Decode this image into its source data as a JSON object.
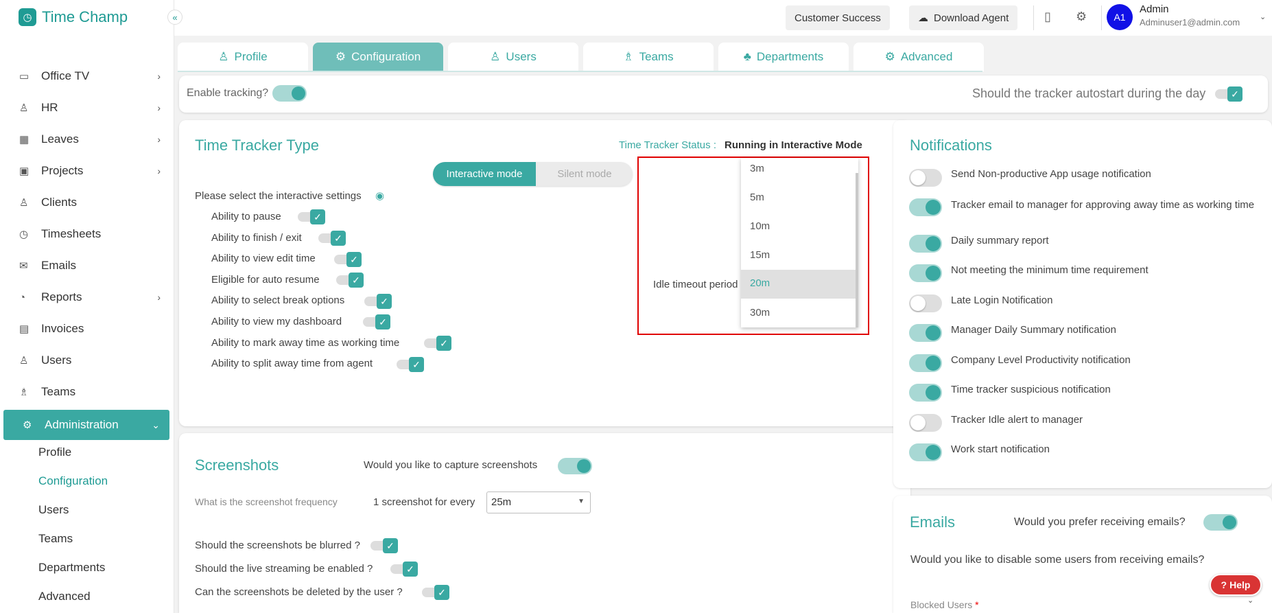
{
  "app": {
    "name": "Time Champ"
  },
  "topbar": {
    "customer_success": "Customer Success",
    "download_agent": "Download Agent",
    "user_name": "Admin",
    "user_email": "Adminuser1@admin.com",
    "avatar_initials": "A1"
  },
  "sidebar": {
    "items": [
      {
        "label": "Office TV"
      },
      {
        "label": "HR"
      },
      {
        "label": "Leaves"
      },
      {
        "label": "Projects"
      },
      {
        "label": "Clients"
      },
      {
        "label": "Timesheets"
      },
      {
        "label": "Emails"
      },
      {
        "label": "Reports"
      },
      {
        "label": "Invoices"
      },
      {
        "label": "Users"
      },
      {
        "label": "Teams"
      },
      {
        "label": "Administration"
      }
    ],
    "sub_items": [
      {
        "label": "Profile"
      },
      {
        "label": "Configuration"
      },
      {
        "label": "Users"
      },
      {
        "label": "Teams"
      },
      {
        "label": "Departments"
      },
      {
        "label": "Advanced"
      }
    ]
  },
  "tabs": [
    {
      "label": "Profile"
    },
    {
      "label": "Configuration"
    },
    {
      "label": "Users"
    },
    {
      "label": "Teams"
    },
    {
      "label": "Departments"
    },
    {
      "label": "Advanced"
    }
  ],
  "tracking": {
    "enable_label": "Enable tracking?",
    "autostart_label": "Should the tracker autostart during the day"
  },
  "tracker_type": {
    "title": "Time Tracker Type",
    "status_label": "Time Tracker Status :",
    "status_value": "Running in Interactive Mode",
    "mode_interactive": "Interactive mode",
    "mode_silent": "Silent mode",
    "select_label": "Please select the interactive settings",
    "settings": [
      {
        "label": "Ability to pause"
      },
      {
        "label": "Ability to finish / exit"
      },
      {
        "label": "Ability to view edit time"
      },
      {
        "label": "Eligible for auto resume"
      },
      {
        "label": "Ability to select break options"
      },
      {
        "label": "Ability to view my dashboard"
      },
      {
        "label": "Ability to mark away time as working time"
      },
      {
        "label": "Ability to split away time from agent"
      }
    ],
    "idle_label": "Idle timeout period",
    "idle_options": [
      "3m",
      "5m",
      "10m",
      "15m",
      "20m",
      "30m"
    ],
    "idle_selected": "20m"
  },
  "screenshots": {
    "title": "Screenshots",
    "capture_label": "Would you like to capture screenshots",
    "frequency_label": "What is the screenshot frequency",
    "every_label": "1 screenshot for every",
    "frequency_value": "25m",
    "blur_label": "Should the screenshots be blurred ?",
    "stream_label": "Should the live streaming be enabled ?",
    "delete_label": "Can the screenshots be deleted by the user ?"
  },
  "notifications": {
    "title": "Notifications",
    "items": [
      {
        "label": "Send Non-productive App usage notification",
        "on": false
      },
      {
        "label": "Tracker email to manager for approving away time as working time",
        "on": true
      },
      {
        "label": "Daily summary report",
        "on": true
      },
      {
        "label": "Not meeting the minimum time requirement",
        "on": true
      },
      {
        "label": "Late Login Notification",
        "on": false
      },
      {
        "label": "Manager Daily Summary notification",
        "on": true
      },
      {
        "label": "Company Level Productivity notification",
        "on": true
      },
      {
        "label": "Time tracker suspicious notification",
        "on": true
      },
      {
        "label": "Tracker Idle alert to manager",
        "on": false
      },
      {
        "label": "Work start notification",
        "on": true
      }
    ]
  },
  "emails": {
    "title": "Emails",
    "prefer_label": "Would you prefer receiving emails?",
    "disable_label": "Would you like to disable some users from receiving emails?",
    "blocked_label": "Blocked Users",
    "required_mark": "*"
  },
  "help": {
    "label": "Help"
  },
  "colors": {
    "accent": "#3aa9a2",
    "highlight_border": "#e00000",
    "help": "#d93434",
    "avatar": "#1111e6"
  }
}
